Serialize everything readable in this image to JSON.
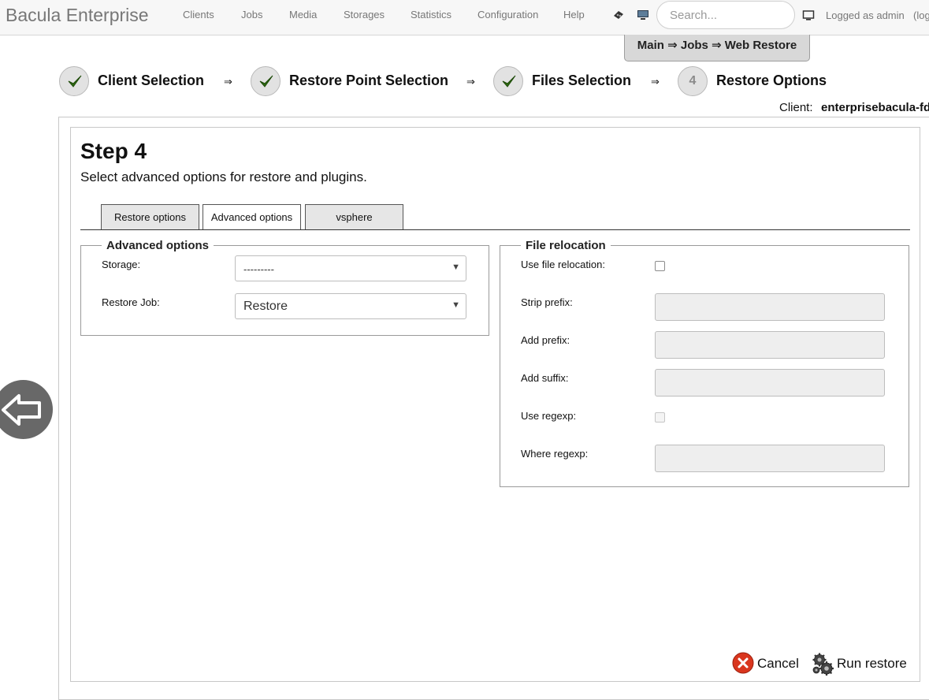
{
  "app": {
    "brand": "Bacula Enterprise"
  },
  "nav": {
    "items": [
      "Clients",
      "Jobs",
      "Media",
      "Storages",
      "Statistics",
      "Configuration",
      "Help"
    ],
    "icons": [
      "tape-icon",
      "monitor-icon"
    ]
  },
  "search": {
    "placeholder": "Search..."
  },
  "user": {
    "logged": "Logged as admin",
    "logout": "(log"
  },
  "breadcrumb": "Main ⇒ Jobs ⇒ Web Restore",
  "wizard": {
    "steps": [
      {
        "label": "Client Selection",
        "state": "done"
      },
      {
        "label": "Restore Point Selection",
        "state": "done"
      },
      {
        "label": "Files Selection",
        "state": "done"
      },
      {
        "label": "Restore Options",
        "state": "current",
        "number": "4"
      }
    ],
    "arrow": "⇒"
  },
  "client": {
    "label": "Client:",
    "value": "enterprisebacula-fd"
  },
  "page": {
    "title": "Step 4",
    "subtitle": "Select advanced options for restore and plugins."
  },
  "tabs": [
    {
      "label": "Restore options",
      "active": false
    },
    {
      "label": "Advanced options",
      "active": true
    },
    {
      "label": "vsphere",
      "active": false
    }
  ],
  "advanced": {
    "legend": "Advanced options",
    "storage_label": "Storage:",
    "storage_value": "---------",
    "restore_job_label": "Restore Job:",
    "restore_job_value": "Restore"
  },
  "relocation": {
    "legend": "File relocation",
    "use_file_relocation_label": "Use file relocation:",
    "strip_prefix_label": "Strip prefix:",
    "add_prefix_label": "Add prefix:",
    "add_suffix_label": "Add suffix:",
    "use_regexp_label": "Use regexp:",
    "where_regexp_label": "Where regexp:"
  },
  "buttons": {
    "cancel": "Cancel",
    "run": "Run restore"
  },
  "colors": {
    "topbar_bg": "#f7f7f7",
    "check_green": "#2f6b12",
    "cancel_red": "#d9361e",
    "back_circle": "#686868"
  }
}
